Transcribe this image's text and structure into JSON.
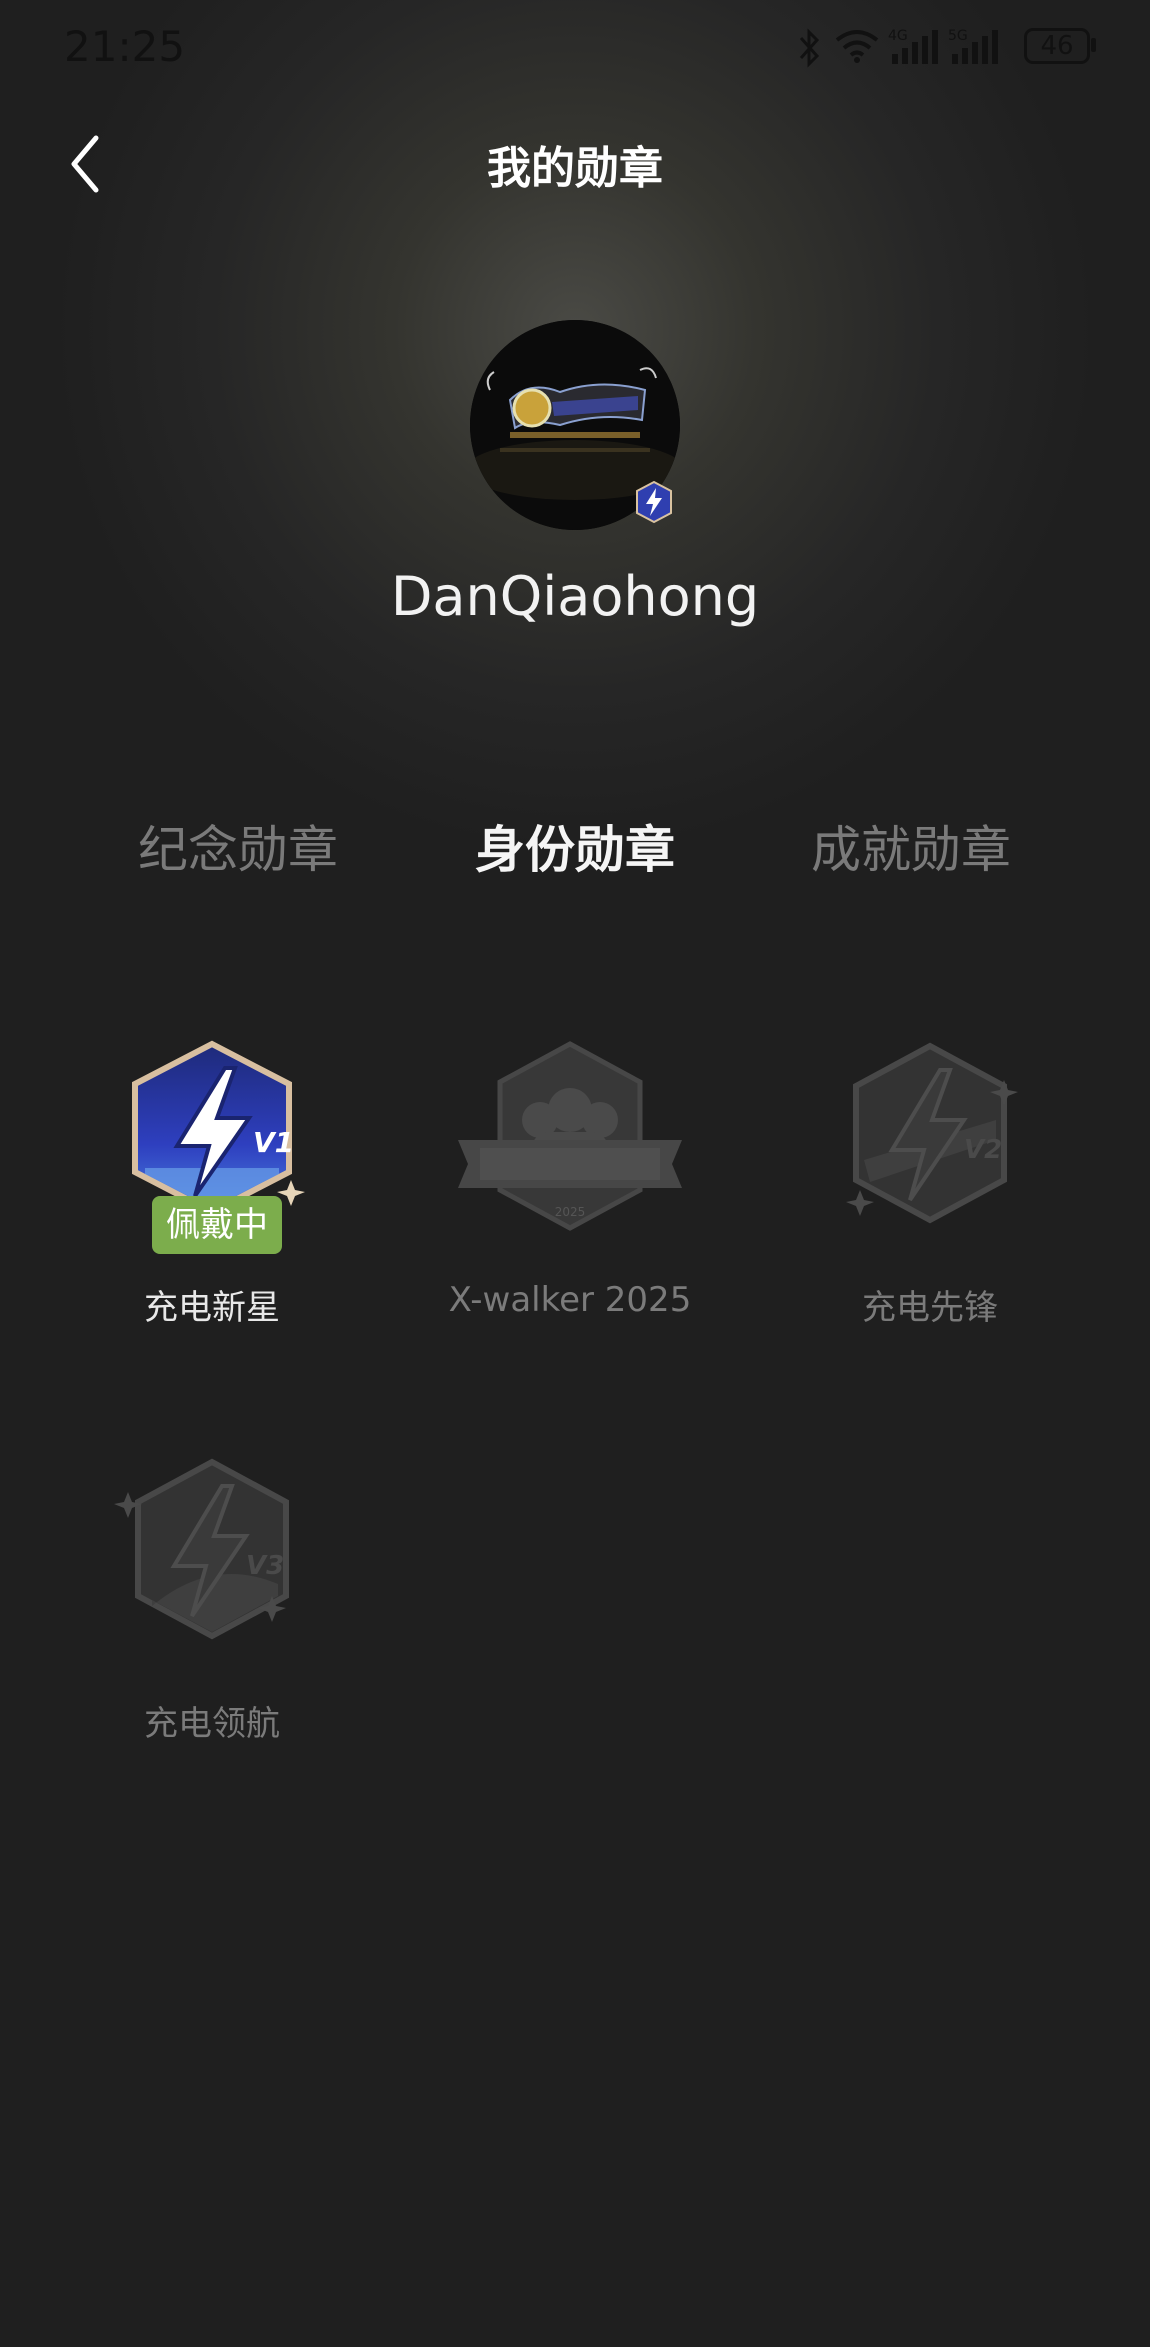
{
  "status_bar": {
    "time": "21:25",
    "battery": "46",
    "network_1": "4G",
    "network_2": "5G"
  },
  "header": {
    "title": "我的勋章",
    "back_icon": "chevron-left-icon"
  },
  "profile": {
    "username": "DanQiaohong"
  },
  "tabs": [
    {
      "label": "纪念勋章",
      "active": false
    },
    {
      "label": "身份勋章",
      "active": true
    },
    {
      "label": "成就勋章",
      "active": false
    }
  ],
  "badges": [
    {
      "name": "充电新星",
      "level": "V1",
      "owned": true,
      "status": "佩戴中"
    },
    {
      "name": "X-walker 2025",
      "owned": false
    },
    {
      "name": "充电先锋",
      "level": "V2",
      "owned": false
    },
    {
      "name": "充电领航",
      "level": "V3",
      "owned": false
    }
  ],
  "colors": {
    "background": "#1f1f1f",
    "wearing_badge": "#7cad4c",
    "badge_blue": "#3a4fd8"
  }
}
